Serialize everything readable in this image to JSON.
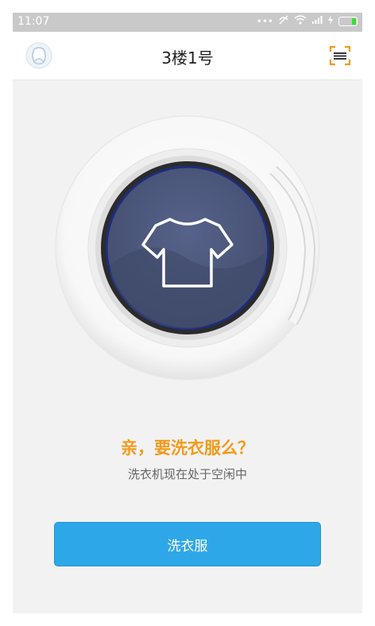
{
  "status_bar": {
    "time": "11:07",
    "icons": [
      "signal-dots-icon",
      "silent-icon",
      "wifi-icon",
      "cellular-icon",
      "charging-icon",
      "battery-icon"
    ]
  },
  "header": {
    "title": "3楼1号",
    "left_icon": "avatar-icon",
    "right_icon": "scan-icon"
  },
  "machine": {
    "window_icon": "tshirt-icon"
  },
  "main": {
    "prompt": "亲，要洗衣服么？",
    "status_text": "洗衣机现在处于空闲中",
    "wash_button_label": "洗衣服"
  },
  "colors": {
    "accent_orange": "#f39a1b",
    "button_blue": "#2ea7e8",
    "drum_navy": "#4a5677"
  }
}
